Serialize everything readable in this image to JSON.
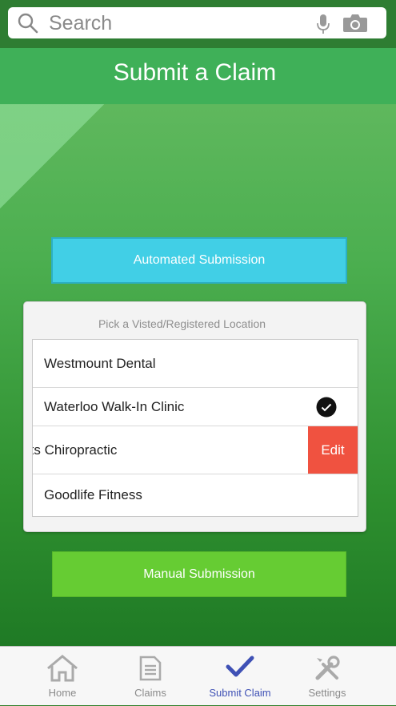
{
  "search": {
    "placeholder": "Search"
  },
  "header": {
    "title": "Submit a Claim"
  },
  "buttons": {
    "automated": "Automated Submission",
    "manual": "Manual Submission"
  },
  "picker": {
    "title": "Pick a Visted/Registered Location",
    "items": [
      {
        "label": "Westmount Dental"
      },
      {
        "label": "Waterloo Walk-In Clinic",
        "selected": true
      },
      {
        "label": "Heights Chiropractic",
        "visible_label": "ights Chiropractic",
        "action": "Edit"
      },
      {
        "label": "Goodlife Fitness"
      }
    ]
  },
  "tabs": [
    {
      "label": "Home",
      "icon": "home-icon"
    },
    {
      "label": "Claims",
      "icon": "document-icon"
    },
    {
      "label": "Submit Claim",
      "icon": "checkmark-icon",
      "active": true
    },
    {
      "label": "Settings",
      "icon": "tools-icon"
    }
  ],
  "colors": {
    "green": "#4caf50",
    "automated_button": "#41cfe6",
    "manual_button": "#66cc33",
    "edit_action": "#f05240",
    "active_tab": "#3f51b5"
  }
}
